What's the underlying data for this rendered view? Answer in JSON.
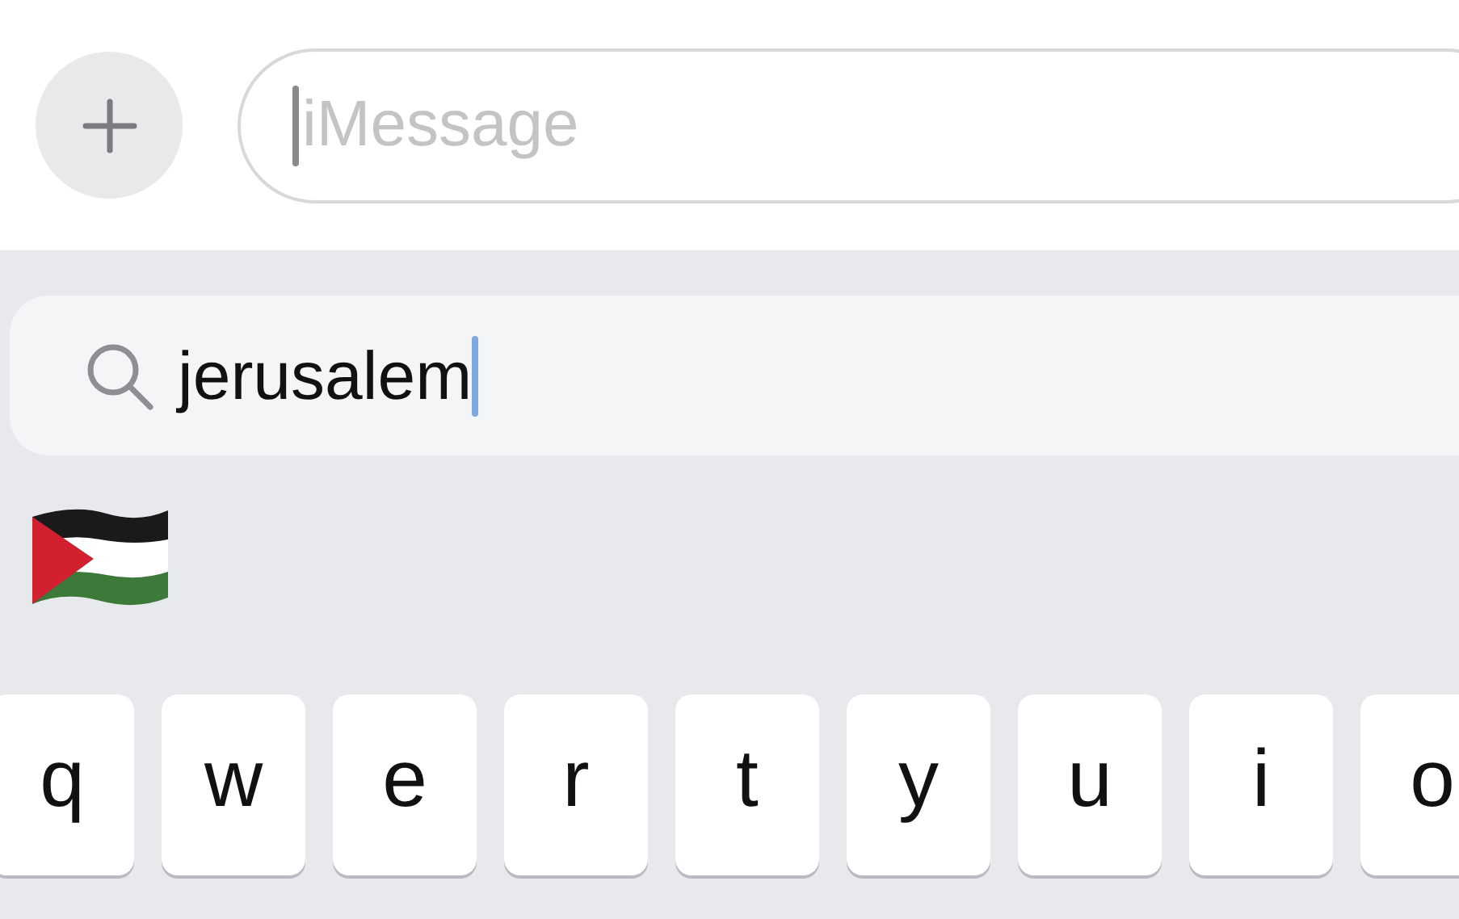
{
  "compose": {
    "placeholder": "iMessage"
  },
  "emoji_search": {
    "value": "jerusalem"
  },
  "suggestions": [
    {
      "kind": "flag"
    }
  ],
  "keys": [
    "q",
    "w",
    "e",
    "r",
    "t",
    "y",
    "u",
    "i",
    "o"
  ]
}
